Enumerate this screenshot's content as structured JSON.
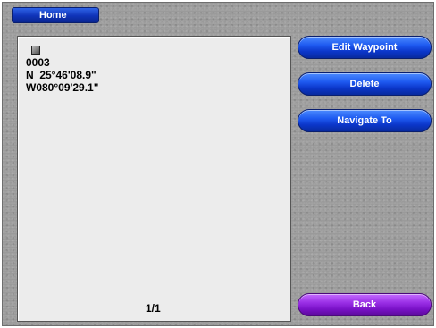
{
  "header": {
    "tab_label": "Home"
  },
  "waypoint": {
    "symbol_icon": "waypoint-square-icon",
    "name": "0003",
    "latitude": "N  25°46'08.9\"",
    "longitude": "W080°09'29.1\""
  },
  "pagination": {
    "label": "1/1"
  },
  "actions": {
    "edit_waypoint": "Edit Waypoint",
    "delete": "Delete",
    "navigate_to": "Navigate To",
    "back": "Back"
  },
  "colors": {
    "button_blue": "#1e5af0",
    "button_purple": "#9a2fe6",
    "panel_bg": "#ececec",
    "device_bg": "#9a9a9a"
  }
}
